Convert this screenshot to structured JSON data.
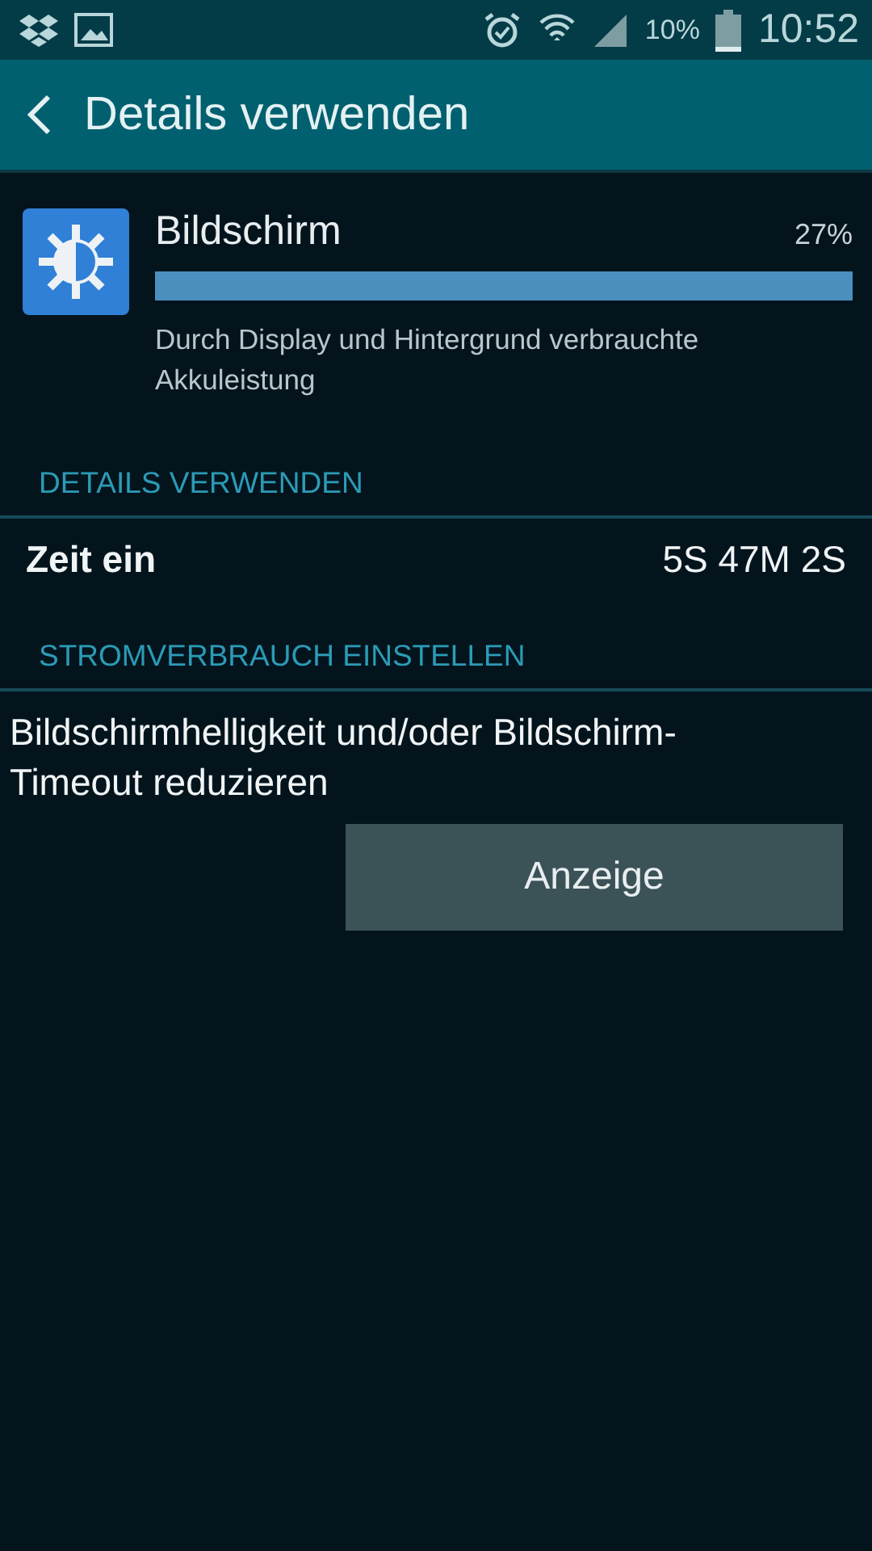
{
  "status_bar": {
    "battery": "10%",
    "time": "10:52"
  },
  "header": {
    "title": "Details verwenden"
  },
  "app": {
    "name": "Bildschirm",
    "percent": "27%",
    "level": 1,
    "description": "Durch Display und Hintergrund verbrauchte Akkuleistung"
  },
  "details": {
    "heading": "DETAILS VERWENDEN",
    "rows": [
      {
        "label": "Zeit ein",
        "value": "5S 47M 2S"
      }
    ]
  },
  "power": {
    "heading": "STROMVERBRAUCH EINSTELLEN",
    "text": "Bildschirmhelligkeit und/oder Bildschirm-Timeout reduzieren",
    "button": "Anzeige"
  }
}
